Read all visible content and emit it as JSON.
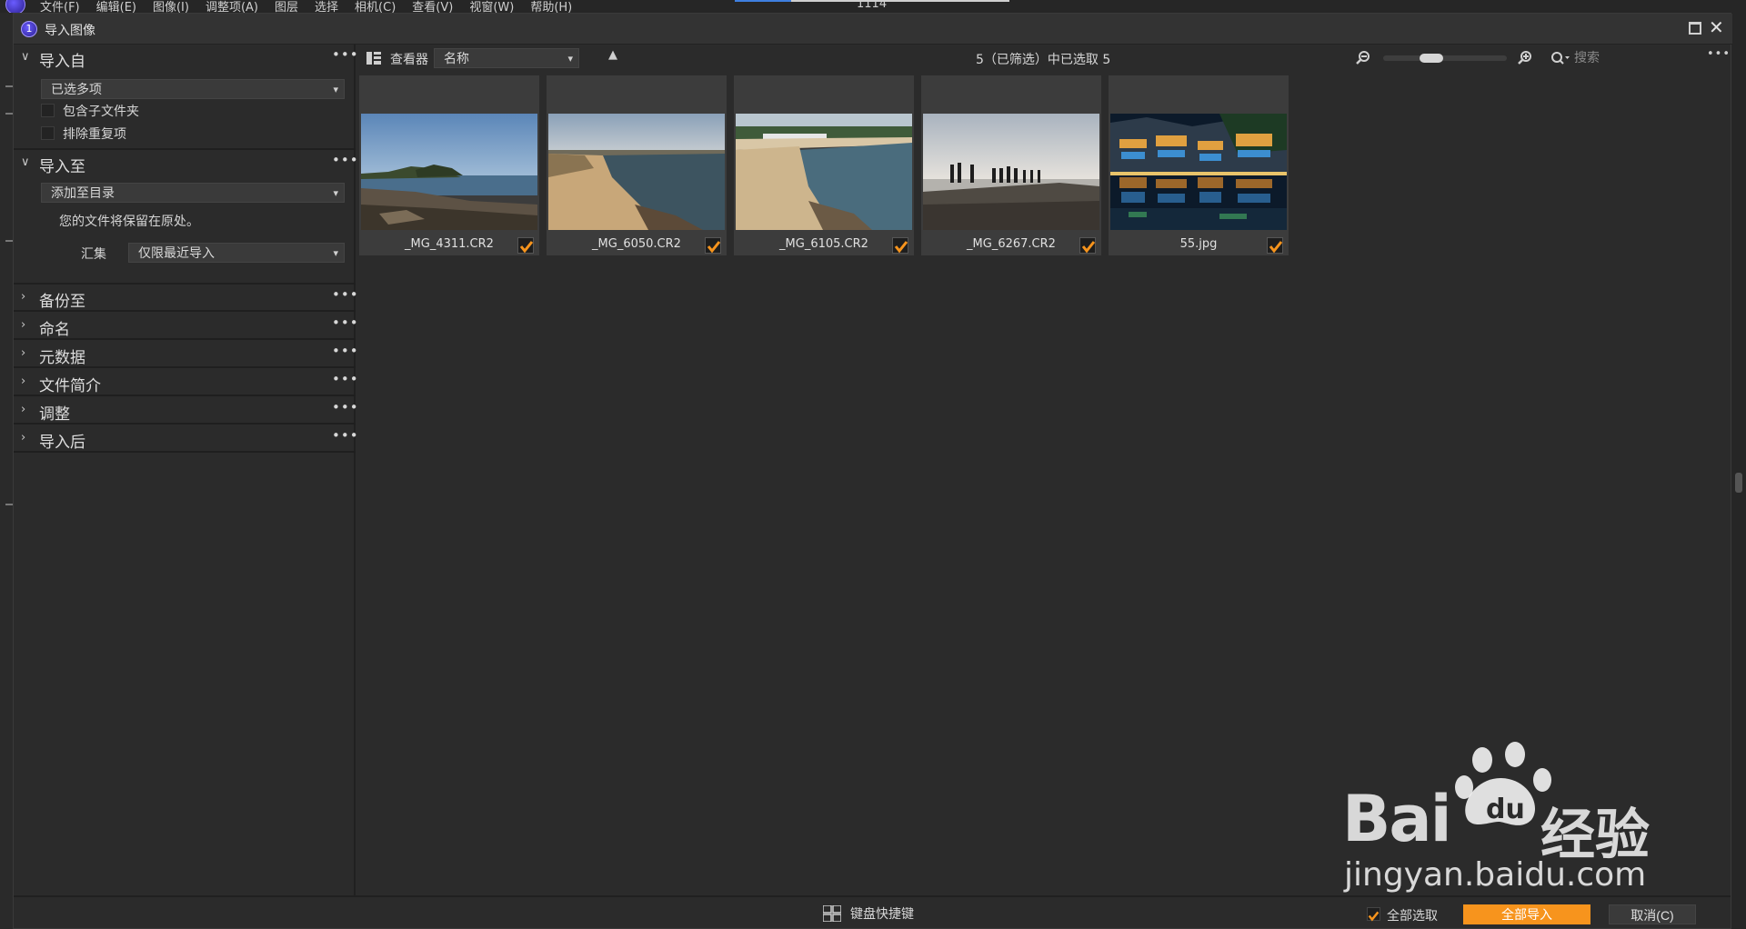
{
  "menubar": {
    "items": [
      "文件(F)",
      "编辑(E)",
      "图像(I)",
      "调整项(A)",
      "图层",
      "选择",
      "相机(C)",
      "查看(V)",
      "视窗(W)",
      "帮助(H)"
    ],
    "center_text": "1114"
  },
  "dialog": {
    "title": "导入图像"
  },
  "left_panel": {
    "import_from": {
      "label": "导入自",
      "source_select": "已选多项",
      "include_subfolders": "包含子文件夹",
      "exclude_duplicates": "排除重复项"
    },
    "import_to": {
      "label": "导入至",
      "target_select": "添加至目录",
      "note": "您的文件将保留在原处。",
      "collection_label": "汇集",
      "collection_select": "仅限最近导入"
    },
    "collapsed_sections": [
      {
        "label": "备份至"
      },
      {
        "label": "命名"
      },
      {
        "label": "元数据"
      },
      {
        "label": "文件简介"
      },
      {
        "label": "调整"
      },
      {
        "label": "导入后"
      }
    ],
    "more_glyph": "•••"
  },
  "toolbar": {
    "viewer_label": "查看器",
    "sort_select": "名称",
    "status": "5（已筛选）中已选取 5",
    "search_placeholder": "搜索",
    "more_glyph": "•••"
  },
  "thumbnails": [
    {
      "filename": "_MG_4311.CR2",
      "checked": true
    },
    {
      "filename": "_MG_6050.CR2",
      "checked": true
    },
    {
      "filename": "_MG_6105.CR2",
      "checked": true
    },
    {
      "filename": "_MG_6267.CR2",
      "checked": true
    },
    {
      "filename": "55.jpg",
      "checked": true
    }
  ],
  "bottombar": {
    "keyboard_shortcuts": "键盘快捷键",
    "select_all": "全部选取",
    "import_all": "全部导入",
    "cancel": "取消(C)"
  },
  "watermark": {
    "brand": "Bai",
    "brand_cn": "经验",
    "url": "jingyan.baidu.com"
  },
  "colors": {
    "accent": "#f7941d",
    "background": "#2b2b2b",
    "card": "#3c3c3c"
  }
}
